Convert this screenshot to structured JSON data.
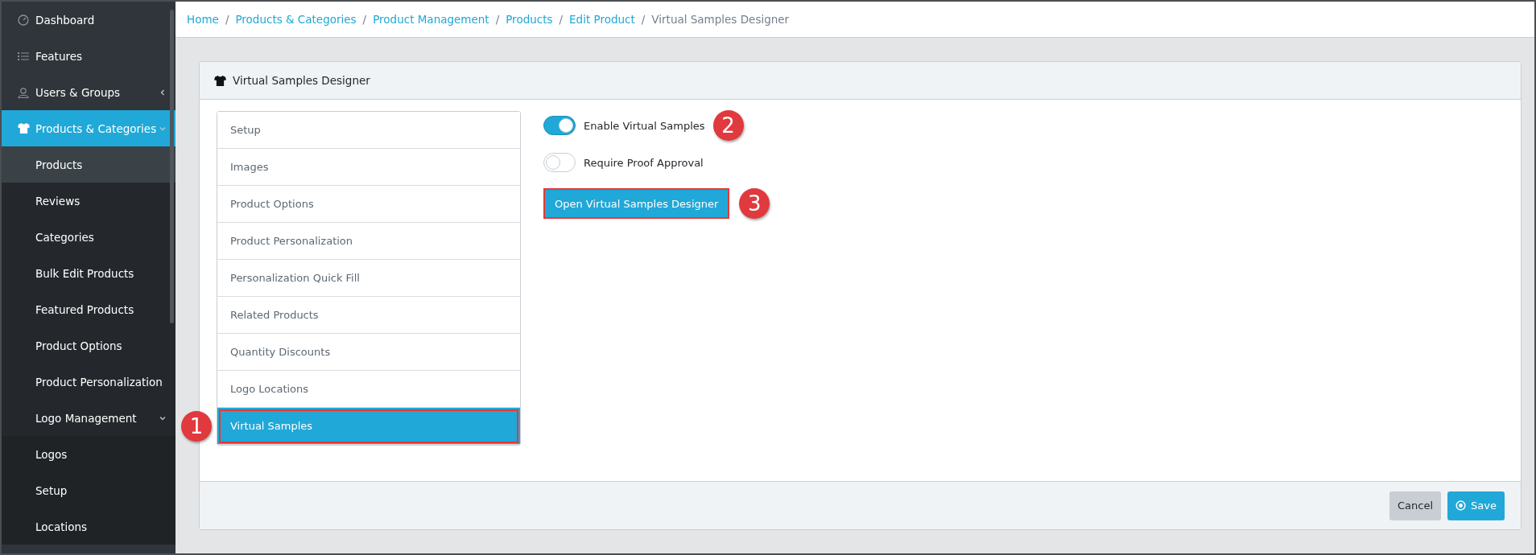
{
  "sidebar": {
    "items": [
      {
        "label": "Dashboard",
        "selected": false
      },
      {
        "label": "Features",
        "selected": false
      },
      {
        "label": "Users & Groups",
        "selected": false,
        "expanded": false
      },
      {
        "label": "Products & Categories",
        "selected": true,
        "expanded": true,
        "children": [
          {
            "label": "Products",
            "selected": true
          },
          {
            "label": "Reviews",
            "selected": false
          },
          {
            "label": "Categories",
            "selected": false
          },
          {
            "label": "Bulk Edit Products",
            "selected": false
          },
          {
            "label": "Featured Products",
            "selected": false
          },
          {
            "label": "Product Options",
            "selected": false
          },
          {
            "label": "Product Personalization",
            "selected": false
          },
          {
            "label": "Logo Management",
            "selected": false,
            "expanded": true,
            "children": [
              {
                "label": "Logos",
                "selected": false
              },
              {
                "label": "Setup",
                "selected": false
              },
              {
                "label": "Locations",
                "selected": false
              }
            ]
          }
        ]
      }
    ]
  },
  "breadcrumb_separator": "/",
  "breadcrumb": [
    "Home",
    "Products & Categories",
    "Product Management",
    "Products",
    "Edit Product",
    "Virtual Samples Designer"
  ],
  "card": {
    "title": "Virtual Samples Designer",
    "tabs": [
      {
        "label": "Setup",
        "selected": false
      },
      {
        "label": "Images",
        "selected": false
      },
      {
        "label": "Product Options",
        "selected": false
      },
      {
        "label": "Product Personalization",
        "selected": false
      },
      {
        "label": "Personalization Quick Fill",
        "selected": false
      },
      {
        "label": "Related Products",
        "selected": false
      },
      {
        "label": "Quantity Discounts",
        "selected": false
      },
      {
        "label": "Logo Locations",
        "selected": false
      },
      {
        "label": "Virtual Samples",
        "selected": true,
        "highlighted": true,
        "callout": "1"
      }
    ],
    "toggles": [
      {
        "label": "Enable Virtual Samples",
        "on": true,
        "callout": "2"
      },
      {
        "label": "Require Proof Approval",
        "on": false
      }
    ],
    "designer_button": {
      "label": "Open Virtual Samples Designer",
      "highlighted": true,
      "callout": "3"
    },
    "footer_buttons": [
      {
        "label": "Cancel",
        "kind": "secondary"
      },
      {
        "label": "Save",
        "kind": "primary"
      }
    ]
  }
}
